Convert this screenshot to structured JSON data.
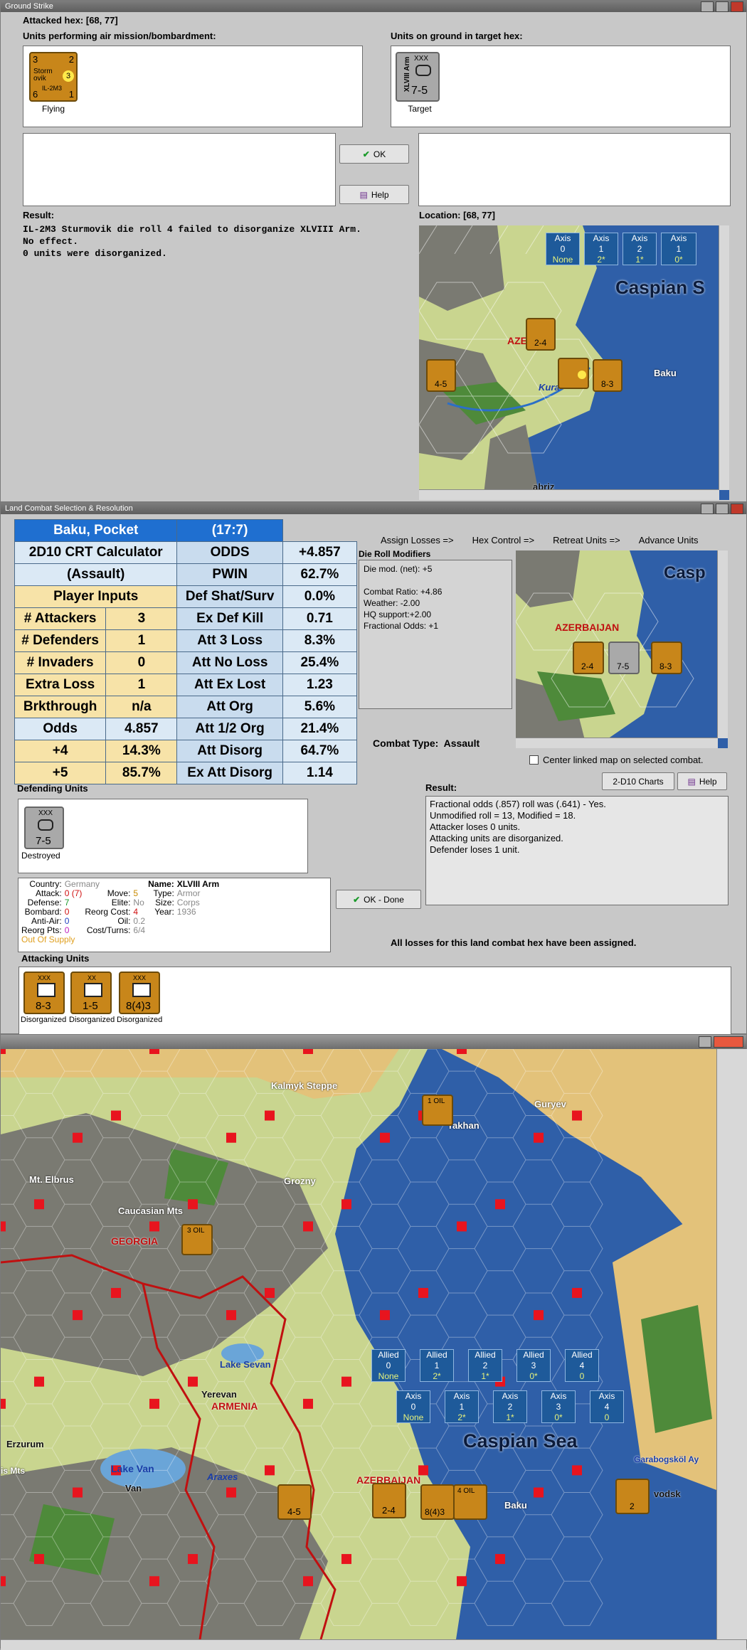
{
  "ground_strike": {
    "title": "Ground Strike",
    "attacked_hex_label": "Attacked hex:",
    "attacked_hex": "[68, 77]",
    "air_units_label": "Units performing air mission/bombardment:",
    "ground_units_label": "Units on ground in target hex:",
    "air_unit": {
      "top_left": "3",
      "top_right": "2",
      "name_lines": [
        "Storm",
        "ovik"
      ],
      "model": "IL-2M3",
      "badge": "3",
      "bottom_left": "6",
      "bottom_right": "1",
      "status": "Flying"
    },
    "ground_unit": {
      "size": "XXX",
      "side_label": "XLVIII Arm",
      "strength": "7-5",
      "status": "Target"
    },
    "ok_label": "OK",
    "help_label": "Help",
    "result_label": "Result:",
    "result_lines": [
      "IL-2M3 Sturmovik die roll 4 failed to disorganize XLVIII Arm.",
      "No effect.",
      "0 units were disorganized."
    ],
    "location_label": "Location:",
    "location": "[68, 77]",
    "map": {
      "axis_boxes": [
        {
          "label": "Axis",
          "val": "0",
          "sub": "None"
        },
        {
          "label": "Axis",
          "val": "1",
          "sub": "2*"
        },
        {
          "label": "Axis",
          "val": "2",
          "sub": "1*"
        },
        {
          "label": "Axis",
          "val": "1",
          "sub": "0*"
        }
      ],
      "sea_label": "Caspian S",
      "region_label": "AZERB",
      "river_label": "Kura",
      "city_label": "Baku",
      "town_label": "abriz",
      "units": [
        {
          "val": "4-5"
        },
        {
          "val": "2-4"
        },
        {
          "val": "8-3"
        }
      ]
    }
  },
  "land_combat": {
    "title": "Land Combat Selection & Resolution",
    "crt": {
      "header_title": "Baku, Pocket",
      "header_odds": "(17:7)",
      "calc_title_1": "2D10 CRT Calculator",
      "calc_title_2": "(Assault)",
      "player_inputs": "Player Inputs",
      "rows_left": [
        {
          "label": "# Attackers",
          "value": "3"
        },
        {
          "label": "# Defenders",
          "value": "1"
        },
        {
          "label": "# Invaders",
          "value": "0"
        },
        {
          "label": "Extra Loss",
          "value": "1"
        },
        {
          "label": "Brkthrough",
          "value": "n/a"
        },
        {
          "label": "Odds",
          "value": "4.857"
        },
        {
          "label": "+4",
          "value": "14.3%"
        },
        {
          "label": "+5",
          "value": "85.7%"
        }
      ],
      "rows_right": [
        {
          "label": "ODDS",
          "value": "+4.857"
        },
        {
          "label": "PWIN",
          "value": "62.7%"
        },
        {
          "label": "Def Shat/Surv",
          "value": "0.0%"
        },
        {
          "label": "Ex Def Kill",
          "value": "0.71"
        },
        {
          "label": "Att 3 Loss",
          "value": "8.3%"
        },
        {
          "label": "Att No Loss",
          "value": "25.4%"
        },
        {
          "label": "Att Ex Lost",
          "value": "1.23"
        },
        {
          "label": "Att Org",
          "value": "5.6%"
        },
        {
          "label": "Att 1/2 Org",
          "value": "21.4%"
        },
        {
          "label": "Att Disorg",
          "value": "64.7%"
        },
        {
          "label": "Ex Att Disorg",
          "value": "1.14"
        }
      ]
    },
    "tabs": [
      "Assign Losses =>",
      "Hex Control =>",
      "Retreat Units =>",
      "Advance Units"
    ],
    "die_roll_title": "Die Roll Modifiers",
    "die_roll_lines": [
      "Die mod. (net): +5",
      "",
      "Combat Ratio: +4.86",
      "Weather: -2.00",
      "HQ support:+2.00",
      "Fractional Odds: +1"
    ],
    "map": {
      "sea_label": "Casp",
      "region_label": "AZERBAIJAN",
      "units": [
        {
          "val": "2-4"
        },
        {
          "val": "7-5"
        },
        {
          "val": "8-3"
        }
      ]
    },
    "combat_type_label": "Combat Type:",
    "combat_type": "Assault",
    "center_map_label": "Center linked map on selected combat.",
    "charts_btn": "2-D10 Charts",
    "help_btn": "Help",
    "defending_label": "Defending Units",
    "defender": {
      "size": "XXX",
      "strength": "7-5",
      "status": "Destroyed"
    },
    "result_label": "Result:",
    "result_lines": [
      "Fractional odds (.857) roll was (.641)  - Yes.",
      "Unmodified roll = 13, Modified = 18.",
      "Attacker loses 0 units.",
      "Attacking units are disorganized.",
      "Defender loses 1 unit."
    ],
    "unit_info": {
      "country_label": "Country:",
      "country": "Germany",
      "name_label": "Name:",
      "name": "XLVIII Arm",
      "attack_label": "Attack:",
      "attack": "0 (7)",
      "move_label": "Move:",
      "move": "5",
      "type_label": "Type:",
      "type": "Armor",
      "defense_label": "Defense:",
      "defense": "7",
      "elite_label": "Elite:",
      "elite": "No",
      "size_label": "Size:",
      "size": "Corps",
      "bombard_label": "Bombard:",
      "bombard": "0",
      "reorg_cost_label": "Reorg Cost:",
      "reorg_cost": "4",
      "year_label": "Year:",
      "year": "1936",
      "antiair_label": "Anti-Air:",
      "antiair": "0",
      "oil_label": "Oil:",
      "oil": "0.2",
      "reorg_pts_label": "Reorg Pts:",
      "reorg_pts": "0",
      "cost_turns_label": "Cost/Turns:",
      "cost_turns": "6/4",
      "supply": "Out Of Supply"
    },
    "done_btn": "OK - Done",
    "losses_msg": "All losses for this land combat hex have been assigned.",
    "attacking_label": "Attacking Units",
    "attackers": [
      {
        "size": "XXX",
        "strength": "8-3",
        "status": "Disorganized"
      },
      {
        "size": "XX",
        "strength": "1-5",
        "status": "Disorganized"
      },
      {
        "size": "XXX",
        "strength": "8(4)3",
        "status": "Disorganized"
      }
    ]
  },
  "main_map": {
    "labels": {
      "kalmyk": "Kalmyk Steppe",
      "guryev": "Guryev",
      "astrakhan": "rakhan",
      "elbrus": "Mt. Elbrus",
      "grozny": "Grozny",
      "caucasian": "Caucasian Mts",
      "georgia": "GEORGIA",
      "lake_sevan": "Lake Sevan",
      "yerevan": "Yerevan",
      "armenia": "ARMENIA",
      "erzurum": "Erzurum",
      "lake_van": "Lake Van",
      "van": "Van",
      "araxes": "Araxes",
      "azerbaijan": "AZERBAIJAN",
      "baku": "Baku",
      "caspian": "Caspian Sea",
      "garabog": "Garabogsköl Ay",
      "krasnovodsk": "vodsk",
      "ts_mts": "is Mts"
    },
    "oil1": "1 OIL",
    "oil3": "3 OIL",
    "oil4": "4 OIL",
    "allied_boxes": [
      {
        "label": "Allied",
        "val": "0",
        "sub": "None"
      },
      {
        "label": "Allied",
        "val": "1",
        "sub": "2*"
      },
      {
        "label": "Allied",
        "val": "2",
        "sub": "1*"
      },
      {
        "label": "Allied",
        "val": "3",
        "sub": "0*"
      },
      {
        "label": "Allied",
        "val": "4",
        "sub": "0"
      }
    ],
    "axis_boxes": [
      {
        "label": "Axis",
        "val": "0",
        "sub": "None"
      },
      {
        "label": "Axis",
        "val": "1",
        "sub": "2*"
      },
      {
        "label": "Axis",
        "val": "2",
        "sub": "1*"
      },
      {
        "label": "Axis",
        "val": "3",
        "sub": "0*"
      },
      {
        "label": "Axis",
        "val": "4",
        "sub": "0"
      }
    ],
    "units": [
      {
        "val": "4-5"
      },
      {
        "val": "2-4"
      },
      {
        "val": "8(4)3"
      },
      {
        "val": "2"
      }
    ]
  },
  "colors": {
    "crt_header": "#1f6fd0",
    "crt_yellow": "#f7e3a8",
    "crt_blue": "#c9dcee",
    "counter": "#c8861a",
    "sea": "#2f5fa8",
    "steppe": "#e3c27a",
    "plains": "#c9d58f",
    "mountain": "#7a7a72"
  }
}
